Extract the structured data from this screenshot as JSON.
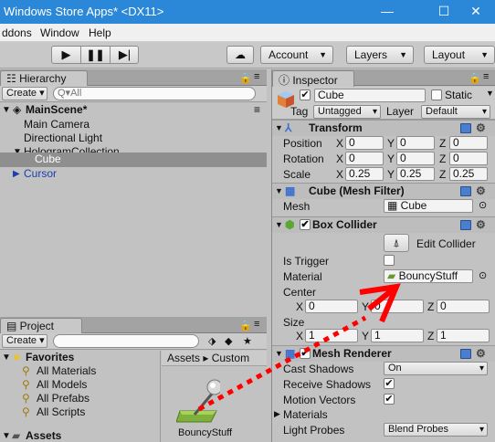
{
  "window": {
    "title": "Windows Store Apps* <DX11>",
    "minimize": "—",
    "maximize": "☐",
    "close": "✕"
  },
  "menu": [
    "ddons",
    "Window",
    "Help"
  ],
  "toolbar": {
    "account": "Account",
    "layers": "Layers",
    "layout": "Layout"
  },
  "hierarchy": {
    "tab": "Hierarchy",
    "create": "Create",
    "search_placeholder": "Q▾All",
    "scene": "MainScene*",
    "items": [
      "Main Camera",
      "Directional Light",
      "HologramCollection",
      "Cube",
      "Cursor"
    ]
  },
  "project": {
    "tab": "Project",
    "create": "Create",
    "favorites": "Favorites",
    "favorites_items": [
      "All Materials",
      "All Models",
      "All Prefabs",
      "All Scripts"
    ],
    "assets": "Assets",
    "breadcrumb": [
      "Assets",
      "Custom"
    ],
    "asset_name": "BouncyStuff"
  },
  "inspector": {
    "tab": "Inspector",
    "name": "Cube",
    "static_label": "Static",
    "tag_label": "Tag",
    "tag_value": "Untagged",
    "layer_label": "Layer",
    "layer_value": "Default",
    "transform": {
      "title": "Transform",
      "rows": [
        {
          "label": "Position",
          "x": "0",
          "y": "0",
          "z": "0"
        },
        {
          "label": "Rotation",
          "x": "0",
          "y": "0",
          "z": "0"
        },
        {
          "label": "Scale",
          "x": "0.25",
          "y": "0.25",
          "z": "0.25"
        }
      ]
    },
    "mesh_filter": {
      "title": "Cube (Mesh Filter)",
      "mesh_label": "Mesh",
      "mesh_value": "Cube"
    },
    "box_collider": {
      "title": "Box Collider",
      "edit_label": "Edit Collider",
      "is_trigger_label": "Is Trigger",
      "material_label": "Material",
      "material_value": "BouncyStuff",
      "center_label": "Center",
      "center": {
        "x": "0",
        "y": "0",
        "z": "0"
      },
      "size_label": "Size",
      "size": {
        "x": "1",
        "y": "1",
        "z": "1"
      }
    },
    "mesh_renderer": {
      "title": "Mesh Renderer",
      "cast_shadows_label": "Cast Shadows",
      "cast_shadows_value": "On",
      "receive_shadows_label": "Receive Shadows",
      "motion_vectors_label": "Motion Vectors",
      "materials_label": "Materials",
      "light_probes_label": "Light Probes",
      "light_probes_value": "Blend Probes"
    },
    "axis": {
      "x": "X",
      "y": "Y",
      "z": "Z"
    }
  },
  "colors": {
    "titlebar": "#2b88d8",
    "selection": "#8f8f8f",
    "arrow": "#ff0000",
    "cursor_link": "#1a3fae"
  }
}
